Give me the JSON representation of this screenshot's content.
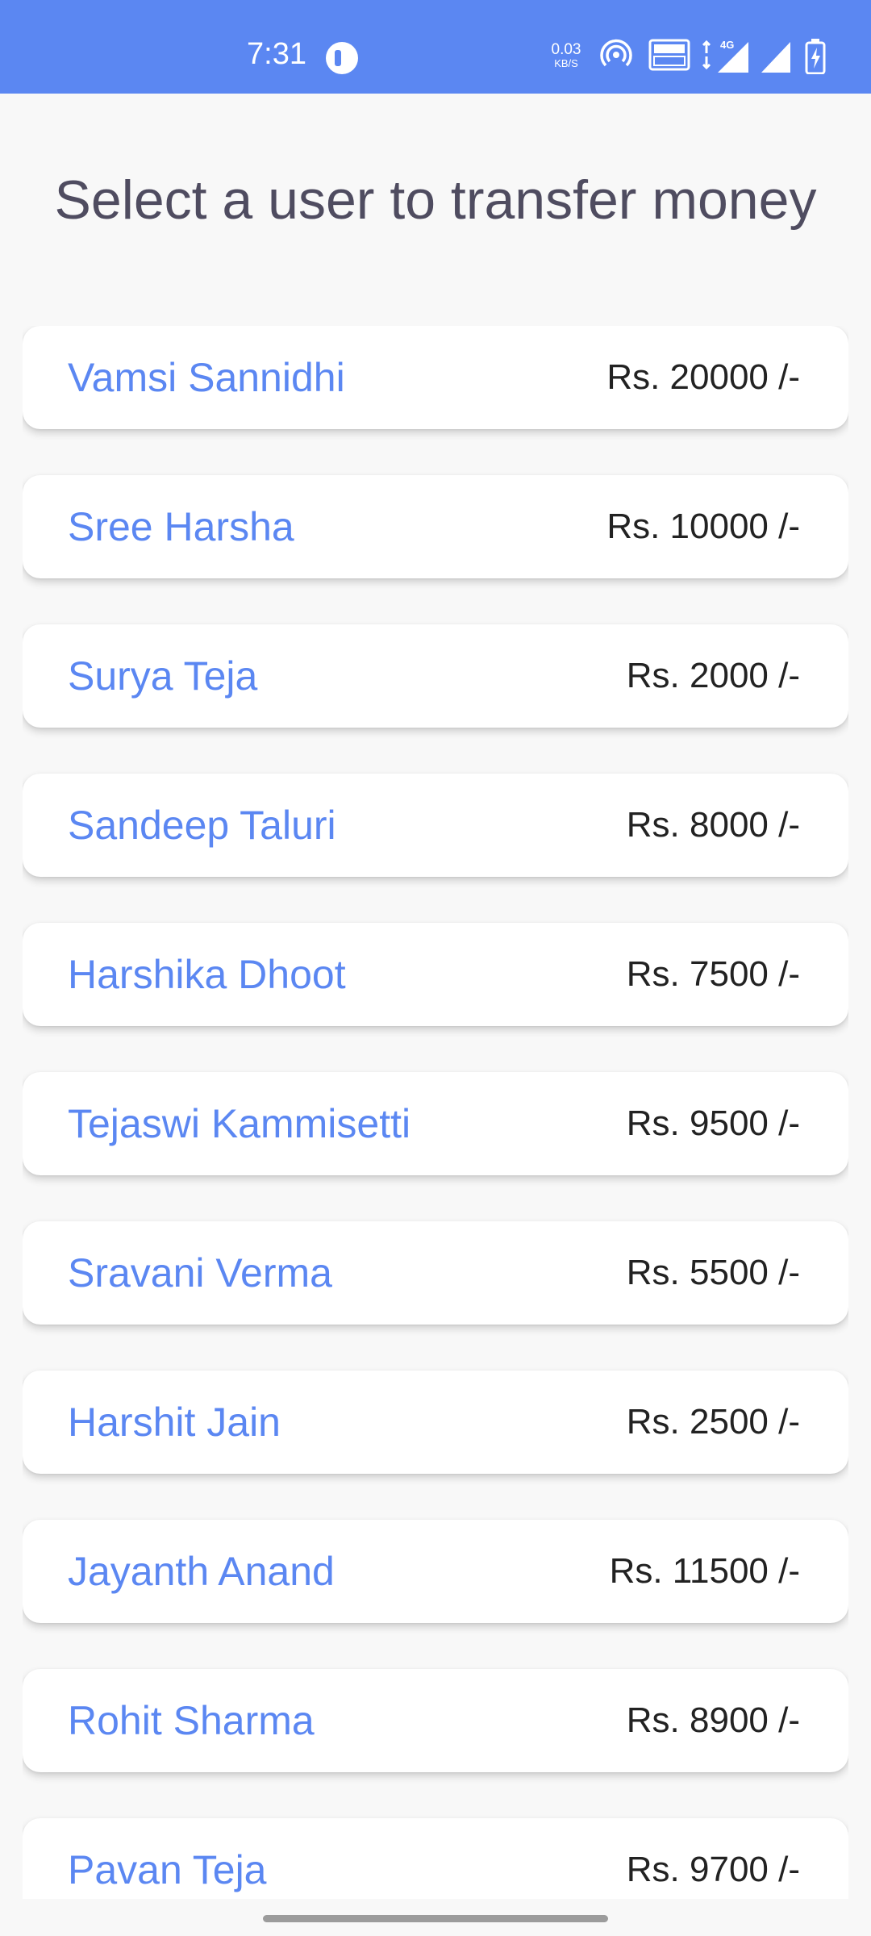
{
  "status_bar": {
    "time": "7:31",
    "net_speed_value": "0.03",
    "net_speed_unit": "KB/S",
    "icons": [
      "app-notification-icon",
      "hotspot-icon",
      "volte-icon",
      "data-4g-icon",
      "signal-icon",
      "signal-icon",
      "battery-charging-icon"
    ],
    "color": "#5b87f2"
  },
  "page": {
    "title": "Select a user to transfer money"
  },
  "users": [
    {
      "name": "Vamsi Sannidhi",
      "balance": "Rs. 20000 /-"
    },
    {
      "name": "Sree Harsha",
      "balance": "Rs. 10000 /-"
    },
    {
      "name": "Surya Teja",
      "balance": "Rs. 2000 /-"
    },
    {
      "name": "Sandeep Taluri",
      "balance": "Rs. 8000 /-"
    },
    {
      "name": "Harshika Dhoot",
      "balance": "Rs. 7500 /-"
    },
    {
      "name": "Tejaswi Kammisetti",
      "balance": "Rs. 9500 /-"
    },
    {
      "name": "Sravani Verma",
      "balance": "Rs. 5500 /-"
    },
    {
      "name": "Harshit Jain",
      "balance": "Rs. 2500 /-"
    },
    {
      "name": "Jayanth Anand",
      "balance": "Rs. 11500 /-"
    },
    {
      "name": "Rohit Sharma",
      "balance": "Rs. 8900 /-"
    },
    {
      "name": "Pavan Teja",
      "balance": "Rs. 9700 /-"
    }
  ],
  "colors": {
    "accent": "#5b87f2",
    "title": "#4f4c60",
    "balance": "#222222",
    "background": "#f8f8f8"
  }
}
